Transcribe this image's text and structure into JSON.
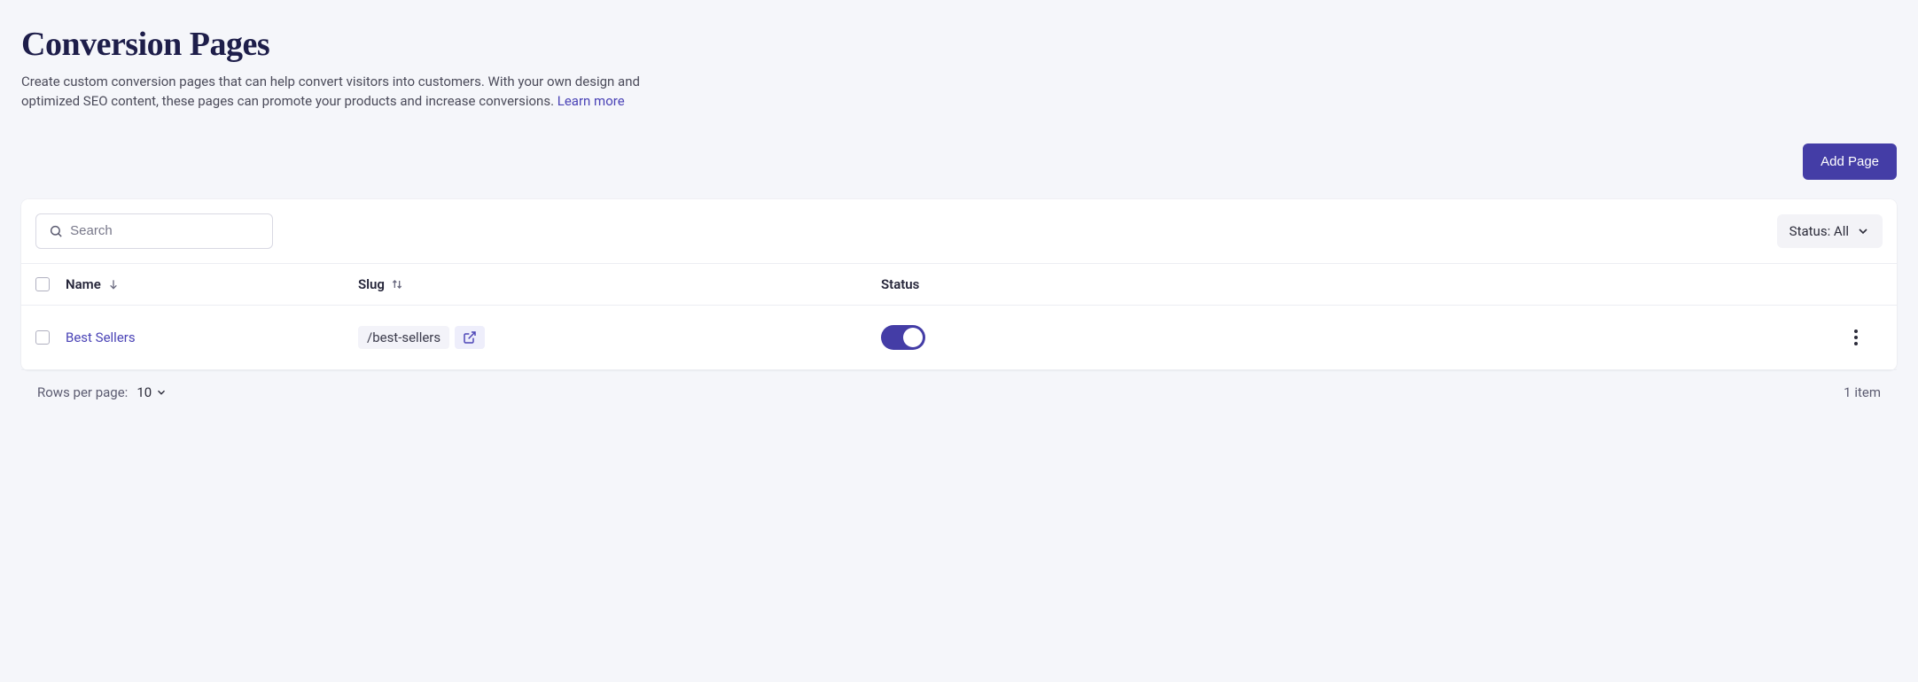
{
  "header": {
    "title": "Conversion Pages",
    "description": "Create custom conversion pages that can help convert visitors into customers. With your own design and optimized SEO content, these pages can promote your products and increase conversions. ",
    "learn_more": "Learn more"
  },
  "actions": {
    "add_page": "Add Page"
  },
  "search": {
    "placeholder": "Search",
    "value": ""
  },
  "filter": {
    "status_label": "Status: All"
  },
  "table": {
    "columns": {
      "name": "Name",
      "slug": "Slug",
      "status": "Status"
    },
    "rows": [
      {
        "name": "Best Sellers",
        "slug": "/best-sellers",
        "status_on": true
      }
    ]
  },
  "pagination": {
    "rows_label": "Rows per page:",
    "rows_value": "10",
    "count_text": "1 item"
  }
}
